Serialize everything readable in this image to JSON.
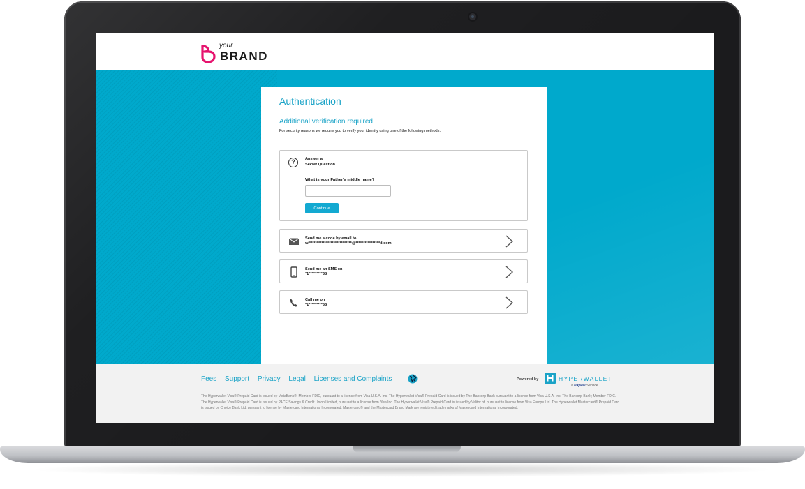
{
  "brand": {
    "your": "your",
    "name": "BRAND"
  },
  "auth": {
    "title": "Authentication",
    "subtitle": "Additional verification required",
    "description": "For security reasons we require you to verify your identity using one of the following methods."
  },
  "secret_question": {
    "label_line1": "Answer a",
    "label_line2": "Secret Question",
    "question": "What is your Father's middle name?",
    "input_value": "",
    "continue_label": "Continue"
  },
  "options": [
    {
      "line1": "Send me a code by email to",
      "line2": "wi****************************@****************d.com",
      "icon": "envelope-icon"
    },
    {
      "line1": "Send me an SMS on",
      "line2": "*1*********38",
      "icon": "mobile-phone-icon"
    },
    {
      "line1": "Call me on",
      "line2": "*1*********38",
      "icon": "phone-icon"
    }
  ],
  "footer": {
    "links": [
      "Fees",
      "Support",
      "Privacy",
      "Legal",
      "Licenses and Complaints"
    ],
    "powered_by": "Powered by",
    "provider": "HYPERWALLET",
    "provider_sub_prefix": "a",
    "provider_sub_brand": "PayPal",
    "provider_sub_suffix": "Service",
    "legal": "The Hyperwallet Visa® Prepaid Card is issued by MetaBank®, Member FDIC, pursuant to a license from Visa U.S.A. Inc. The Hyperwallet Visa® Prepaid Card is issued by The Bancorp Bank pursuant to a license from Visa U.S.A. Inc. The Bancorp Bank; Member FDIC. The Hyperwallet Visa® Prepaid Card is issued by PACE Savings & Credit Union Limited, pursuant to a license from Visa Inc. The Hyperwallet Visa® Prepaid Card is issued by Valitor hf. pursuant to license from Visa Europe Ltd. The Hyperwallet Mastercard® Prepaid Card is issued by Choice Bank Ltd. pursuant to license by Mastercard International Incorporated. Mastercard® and the Mastercard Brand Mark are registered trademarks of Mastercard International Incorporated."
  },
  "colors": {
    "accent": "#1aa3c7",
    "hero": "#00a9cc",
    "brand_mark": "#e6136e"
  }
}
